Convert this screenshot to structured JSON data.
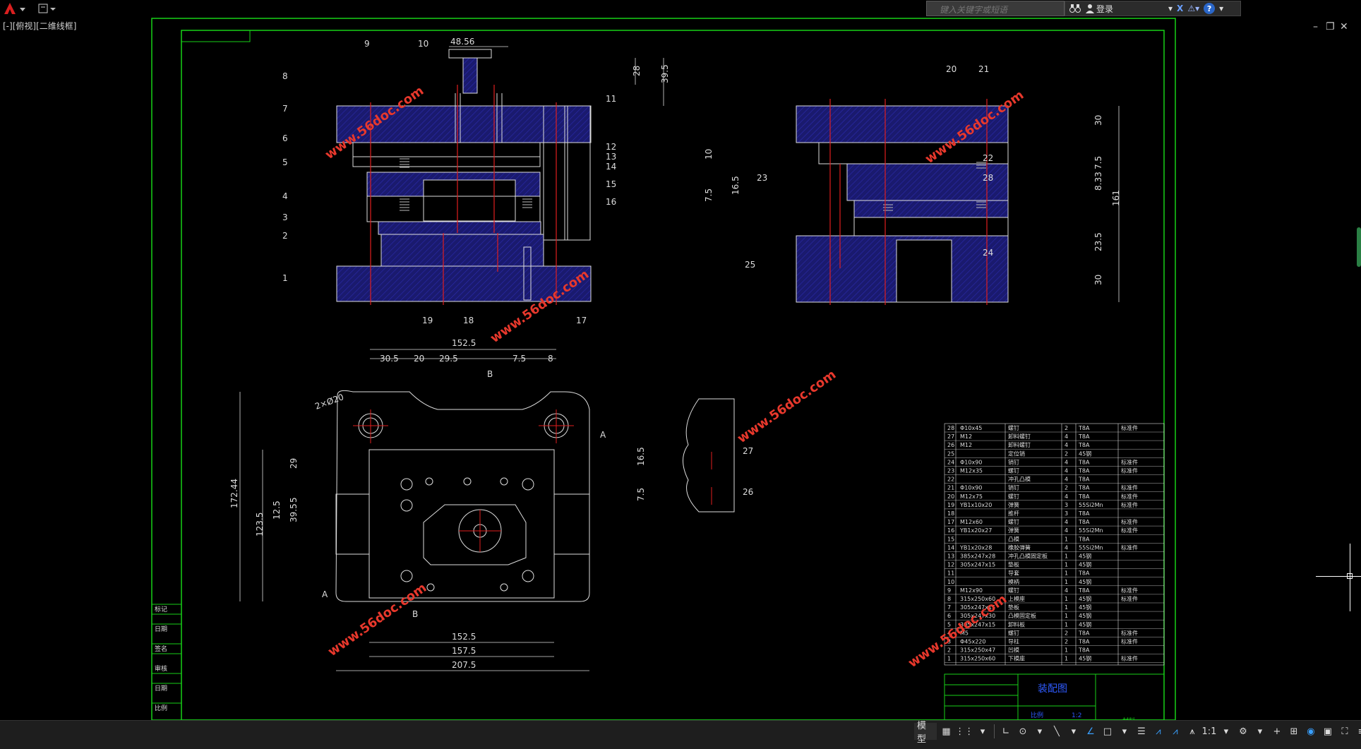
{
  "toolbar": {
    "search_placeholder": "键入关键字或短语",
    "login_label": "登录",
    "exchange_label": "X",
    "help_label": "?",
    "viewport_label": "[-][俯视][二维线框]"
  },
  "window_controls": {
    "minimize": "–",
    "restore": "❐",
    "close": "✕"
  },
  "drawing": {
    "top_dims": [
      "48.56",
      "28",
      "39.5"
    ],
    "callouts_left": [
      "9",
      "10",
      "8",
      "11",
      "7",
      "12",
      "13",
      "6",
      "14",
      "5",
      "15",
      "16",
      "4",
      "3",
      "2",
      "1",
      "19",
      "18",
      "17"
    ],
    "callouts_right": [
      "20",
      "21",
      "22",
      "28",
      "23",
      "25",
      "24"
    ],
    "right_dims": [
      "30",
      "7.5",
      "161",
      "8.33",
      "23.5",
      "30",
      "10",
      "16.5",
      "7.5"
    ],
    "plan_dims_top": [
      "152.5",
      "30.5",
      "20",
      "29.5",
      "7.5",
      "8"
    ],
    "plan_dims_left": [
      "172.44",
      "123.5",
      "12.5",
      "39.5",
      "29",
      "5"
    ],
    "plan_dims_bottom": [
      "152.5",
      "157.5",
      "207.5"
    ],
    "plan_dims_right": [
      "16.5",
      "7.5"
    ],
    "hole_label": "2×Ø20",
    "section_labels": [
      "B",
      "A",
      "A",
      "B"
    ],
    "detail_callouts": [
      "27",
      "26"
    ],
    "watermark": "www.56doc.com"
  },
  "bom": {
    "rows": [
      [
        "28",
        "Φ10x45",
        "螺钉",
        "2",
        "T8A",
        "标准件"
      ],
      [
        "27",
        "M12",
        "卸料螺钉",
        "4",
        "T8A",
        ""
      ],
      [
        "26",
        "M12",
        "卸料螺钉",
        "4",
        "T8A",
        ""
      ],
      [
        "25",
        "",
        "定位销",
        "2",
        "45钢",
        ""
      ],
      [
        "24",
        "Φ10x90",
        "销钉",
        "4",
        "T8A",
        "标准件"
      ],
      [
        "23",
        "M12x35",
        "螺钉",
        "4",
        "T8A",
        "标准件"
      ],
      [
        "22",
        "",
        "冲孔凸模",
        "4",
        "T8A",
        ""
      ],
      [
        "21",
        "Φ10x90",
        "销钉",
        "2",
        "T8A",
        "标准件"
      ],
      [
        "20",
        "M12x75",
        "螺钉",
        "4",
        "T8A",
        "标准件"
      ],
      [
        "19",
        "YB1x10x20",
        "弹簧",
        "3",
        "55Si2Mn",
        "标准件"
      ],
      [
        "18",
        "",
        "推杆",
        "3",
        "T8A",
        ""
      ],
      [
        "17",
        "M12x60",
        "螺钉",
        "4",
        "T8A",
        "标准件"
      ],
      [
        "16",
        "YB1x20x27",
        "弹簧",
        "4",
        "55Si2Mn",
        "标准件"
      ],
      [
        "15",
        "",
        "凸模",
        "1",
        "T8A",
        ""
      ],
      [
        "14",
        "YB1x20x28",
        "橡胶弹簧",
        "4",
        "55Si2Mn",
        "标准件"
      ],
      [
        "13",
        "385x247x28",
        "冲孔凸模固定板",
        "1",
        "45钢",
        ""
      ],
      [
        "12",
        "305x247x15",
        "垫板",
        "1",
        "45钢",
        ""
      ],
      [
        "11",
        "",
        "导套",
        "1",
        "T8A",
        ""
      ],
      [
        "10",
        "",
        "模柄",
        "1",
        "45钢",
        ""
      ],
      [
        "9",
        "M12x90",
        "螺钉",
        "4",
        "T8A",
        "标准件"
      ],
      [
        "8",
        "315x250x60",
        "上模座",
        "1",
        "45钢",
        "标准件"
      ],
      [
        "7",
        "305x247x15",
        "垫板",
        "1",
        "45钢",
        ""
      ],
      [
        "6",
        "305x247x30",
        "凸模固定板",
        "1",
        "45钢",
        ""
      ],
      [
        "5",
        "305x247x15",
        "卸料板",
        "1",
        "45钢",
        ""
      ],
      [
        "4",
        "M5",
        "螺钉",
        "2",
        "T8A",
        "标准件"
      ],
      [
        "3",
        "Φ45x220",
        "导柱",
        "2",
        "T8A",
        "标准件"
      ],
      [
        "2",
        "315x250x47",
        "凹模",
        "1",
        "T8A",
        ""
      ],
      [
        "1",
        "315x250x60",
        "下模座",
        "1",
        "45钢",
        "标准件"
      ]
    ],
    "title_block_name": "装配图",
    "scale_label": "比例",
    "scale_value": "1:2",
    "material_label": "材料"
  },
  "left_strip_labels": [
    "标记",
    "日期",
    "签名",
    "审核",
    "日期",
    "比例"
  ],
  "status": {
    "model_tab": "模型",
    "annotation_scale": "1:1"
  },
  "colors": {
    "frame_green": "#17d117",
    "part_fill": "#1a1a6e",
    "center_red": "#e01e1e",
    "annotation_blue": "#2f5bff",
    "watermark_red": "#e8382c"
  }
}
